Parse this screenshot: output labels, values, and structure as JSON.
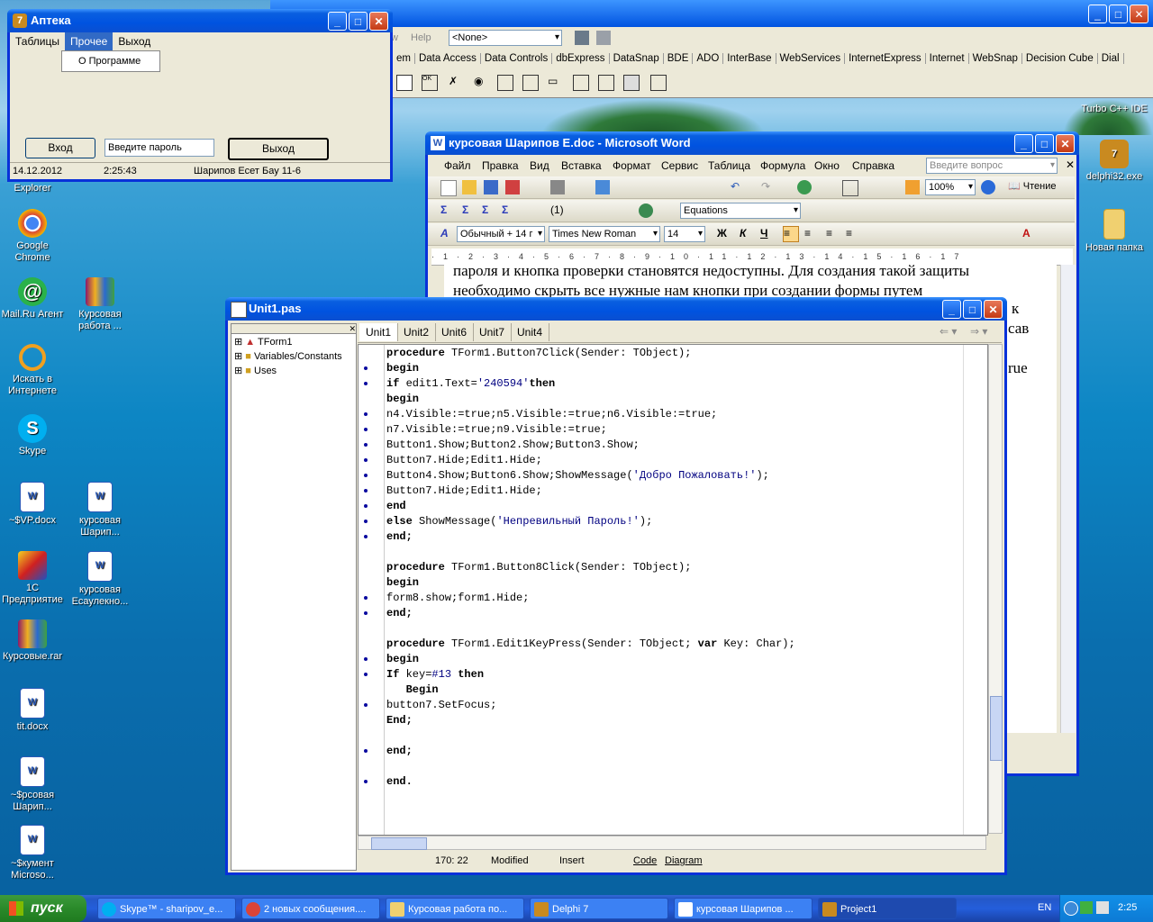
{
  "desktop_icons": [
    {
      "label": "Explorer",
      "icon": "ie-icon"
    },
    {
      "label": "Google Chrome",
      "icon": "chrome-icon"
    },
    {
      "label": "Mail.Ru Агент",
      "icon": "mailru-icon"
    },
    {
      "label": "Курсовая работа ...",
      "icon": "rar-icon"
    },
    {
      "label": "Искать в Интернете",
      "icon": "search-icon"
    },
    {
      "label": "Skype",
      "icon": "skype-icon"
    },
    {
      "label": "~$VP.docx",
      "icon": "word-doc-icon"
    },
    {
      "label": "курсовая Шарип...",
      "icon": "word-doc-icon"
    },
    {
      "label": "1С Предприятие",
      "icon": "1c-icon"
    },
    {
      "label": "курсовая Есаулекно...",
      "icon": "word-doc-icon"
    },
    {
      "label": "Курсовые.rar",
      "icon": "rar-icon"
    },
    {
      "label": "tit.docx",
      "icon": "word-doc-icon"
    },
    {
      "label": "~$рсовая Шарип...",
      "icon": "word-doc-icon"
    },
    {
      "label": "~$кумент Microso...",
      "icon": "word-doc-icon"
    },
    {
      "label": "Turbo C++ IDE",
      "icon": "turbo-icon"
    },
    {
      "label": "delphi32.exe",
      "icon": "delphi-icon"
    },
    {
      "label": "Новая папка",
      "icon": "folder-icon"
    }
  ],
  "delphi_ide": {
    "menu_partial": [
      "w",
      "Help"
    ],
    "component_combo": "<None>",
    "palette_tabs": [
      "em",
      "Data Access",
      "Data Controls",
      "dbExpress",
      "DataSnap",
      "BDE",
      "ADO",
      "InterBase",
      "WebServices",
      "InternetExpress",
      "Internet",
      "WebSnap",
      "Decision Cube",
      "Dial"
    ]
  },
  "apteka": {
    "title": "Аптека",
    "menu": [
      "Таблицы",
      "Прочее",
      "Выход"
    ],
    "dropdown_item": "О Программе",
    "login_button": "Вход",
    "password_input": "Введите пароль",
    "exit_button": "Выход",
    "status": [
      "14.12.2012",
      "2:25:43",
      "Шарипов Есет Бау 11-6"
    ]
  },
  "word": {
    "title": "курсовая Шарипов Е.doc - Microsoft Word",
    "menu": [
      "Файл",
      "Правка",
      "Вид",
      "Вставка",
      "Формат",
      "Сервис",
      "Таблица",
      "Формула",
      "Окно",
      "Справка"
    ],
    "help_placeholder": "Введите вопрос",
    "zoom": "100%",
    "read_button": "Чтение",
    "equations_combo": "Equations",
    "style_combo": "Обычный + 14 г",
    "font_combo": "Times New Roman",
    "size_combo": "14",
    "bold": "Ж",
    "italic": "К",
    "underline": "Ч",
    "doc_line1": "пароля и кнопка проверки становятся недоступны. Для создания такой защиты",
    "doc_line2": "необходимо скрыть все нужные нам кнопки при создании формы путем",
    "doc_frag1": "к",
    "doc_frag2": "сав",
    "doc_frag3": "rue"
  },
  "unit": {
    "title": "Unit1.pas",
    "tree": [
      "TForm1",
      "Variables/Constants",
      "Uses"
    ],
    "tabs": [
      "Unit1",
      "Unit2",
      "Unit6",
      "Unit7",
      "Unit4"
    ],
    "status_pos": "170:  22",
    "status_modified": "Modified",
    "status_insert": "Insert",
    "view_tabs": [
      "Code",
      "Diagram"
    ]
  },
  "code_lines": [
    [
      {
        "t": "procedure",
        "k": "kw"
      },
      {
        "t": " TForm1.Button7Click(Sender: TObject);"
      }
    ],
    [
      {
        "t": "begin",
        "k": "kw"
      }
    ],
    [
      {
        "t": "if",
        "k": "kw"
      },
      {
        "t": " edit1.Text="
      },
      {
        "t": "'240594'",
        "k": "str"
      },
      {
        "t": "then",
        "k": "kw"
      }
    ],
    [
      {
        "t": "begin",
        "k": "kw"
      }
    ],
    [
      {
        "t": "n4.Visible:=true;n5.Visible:=true;n6.Visible:=true;"
      }
    ],
    [
      {
        "t": "n7.Visible:=true;n9.Visible:=true;"
      }
    ],
    [
      {
        "t": "Button1.Show;Button2.Show;Button3.Show;"
      }
    ],
    [
      {
        "t": "Button7.Hide;Edit1.Hide;"
      }
    ],
    [
      {
        "t": "Button4.Show;Button6.Show;ShowMessage("
      },
      {
        "t": "'Добро Пожаловать!'",
        "k": "str"
      },
      {
        "t": ");"
      }
    ],
    [
      {
        "t": "Button7.Hide;Edit1.Hide;"
      }
    ],
    [
      {
        "t": "end",
        "k": "kw"
      }
    ],
    [
      {
        "t": "else",
        "k": "kw"
      },
      {
        "t": " ShowMessage("
      },
      {
        "t": "'Непревильный Пароль!'",
        "k": "str"
      },
      {
        "t": ");"
      }
    ],
    [
      {
        "t": "end;",
        "k": "kw"
      }
    ],
    [],
    [
      {
        "t": "procedure",
        "k": "kw"
      },
      {
        "t": " TForm1.Button8Click(Sender: TObject);"
      }
    ],
    [
      {
        "t": "begin",
        "k": "kw"
      }
    ],
    [
      {
        "t": "form8.show;form1.Hide;"
      }
    ],
    [
      {
        "t": "end;",
        "k": "kw"
      }
    ],
    [],
    [
      {
        "t": "procedure",
        "k": "kw"
      },
      {
        "t": " TForm1.Edit1KeyPress(Sender: TObject; "
      },
      {
        "t": "var",
        "k": "kw"
      },
      {
        "t": " Key: Char);"
      }
    ],
    [
      {
        "t": "begin",
        "k": "kw"
      }
    ],
    [
      {
        "t": "If",
        "k": "kw"
      },
      {
        "t": " key="
      },
      {
        "t": "#13",
        "k": "str"
      },
      {
        "t": " "
      },
      {
        "t": "then",
        "k": "kw"
      }
    ],
    [
      {
        "t": "   Begin",
        "k": "kw"
      }
    ],
    [
      {
        "t": "button7.SetFocus;"
      }
    ],
    [
      {
        "t": "End;",
        "k": "kw"
      }
    ],
    [],
    [
      {
        "t": "end;",
        "k": "kw"
      }
    ],
    [],
    [
      {
        "t": "end.",
        "k": "kw"
      }
    ]
  ],
  "gutter_dots": [
    1,
    2,
    4,
    5,
    6,
    7,
    8,
    9,
    10,
    11,
    12,
    16,
    17,
    20,
    21,
    23,
    26,
    28
  ],
  "taskbar": {
    "start": "пуск",
    "items": [
      "Skype™ - sharipov_e...",
      "2 новых сообщения....",
      "Курсовая работа по...",
      "Delphi 7",
      "курсовая Шарипов ...",
      "Project1"
    ],
    "lang": "EN",
    "clock": "2:25"
  }
}
